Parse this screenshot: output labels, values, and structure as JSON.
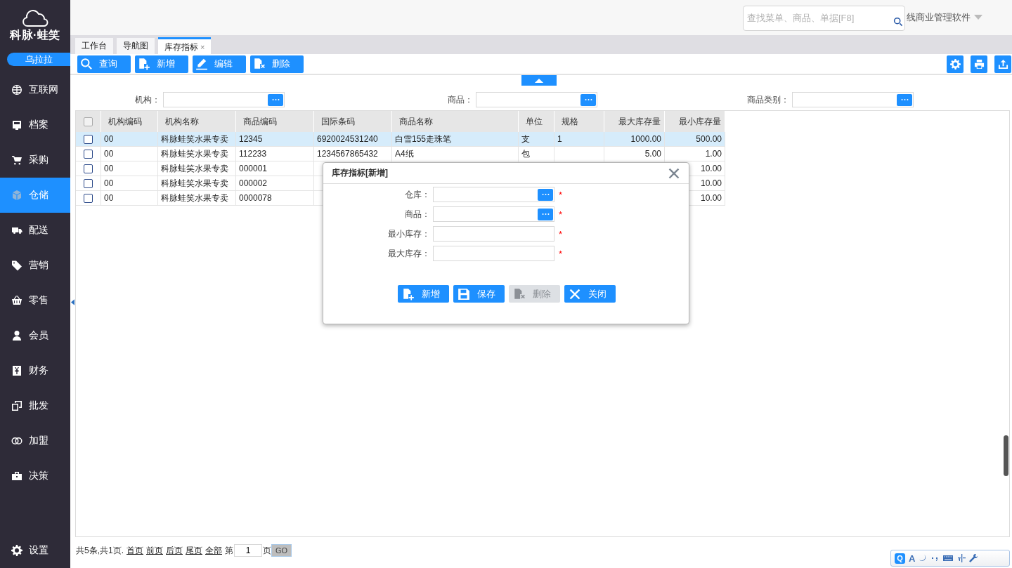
{
  "sidebar": {
    "logo": "科脉·蛙笑",
    "user": "乌拉拉",
    "items": [
      {
        "label": "互联网",
        "kind": "globe",
        "selected": false
      },
      {
        "label": "档案",
        "kind": "file",
        "selected": false
      },
      {
        "label": "采购",
        "kind": "cart",
        "selected": false
      },
      {
        "label": "仓储",
        "kind": "box",
        "selected": true
      },
      {
        "label": "配送",
        "kind": "truck",
        "selected": false
      },
      {
        "label": "营销",
        "kind": "tag",
        "selected": false
      },
      {
        "label": "零售",
        "kind": "basket",
        "selected": false
      },
      {
        "label": "会员",
        "kind": "user",
        "selected": false
      },
      {
        "label": "财务",
        "kind": "yen",
        "selected": false
      },
      {
        "label": "批发",
        "kind": "share",
        "selected": false
      },
      {
        "label": "加盟",
        "kind": "rings",
        "selected": false
      },
      {
        "label": "决策",
        "kind": "briefcase",
        "selected": false
      }
    ],
    "settings": "设置"
  },
  "header": {
    "search": {
      "placeholder": "查找菜单、商品、单据[F8]"
    },
    "product": "线商业管理软件"
  },
  "tabs": [
    {
      "label": "工作台",
      "selected": false
    },
    {
      "label": "导航图",
      "selected": false
    },
    {
      "label": "库存指标",
      "selected": true,
      "close_mark": "×"
    }
  ],
  "toolbar": {
    "buttons": [
      {
        "label": "查询",
        "kind": "search"
      },
      {
        "label": "新增",
        "kind": "add"
      },
      {
        "label": "编辑",
        "kind": "pencil"
      },
      {
        "label": "删除",
        "kind": "del"
      }
    ],
    "tools": [
      {
        "kind": "gear"
      },
      {
        "kind": "print"
      },
      {
        "kind": "export"
      }
    ]
  },
  "filters": [
    {
      "label": "机构：",
      "picker": true
    },
    {
      "label": "商品：",
      "picker": true
    },
    {
      "label": "商品类别：",
      "picker": true
    }
  ],
  "table": {
    "header_checked": false,
    "columns": [
      {
        "name": "机构编码",
        "numeric": false
      },
      {
        "name": "机构名称",
        "numeric": false
      },
      {
        "name": "商品编码",
        "numeric": false
      },
      {
        "name": "国际条码",
        "numeric": false
      },
      {
        "name": "商品名称",
        "numeric": false
      },
      {
        "name": "单位",
        "numeric": false
      },
      {
        "name": "规格",
        "numeric": false
      },
      {
        "name": "最大库存量",
        "numeric": true
      },
      {
        "name": "最小库存量",
        "numeric": true
      }
    ],
    "rows": [
      {
        "selected": true,
        "checked": false,
        "cells": [
          "00",
          "科脉蛙笑水果专卖",
          "12345",
          "6920024531240",
          "白雪155走珠笔",
          "支",
          "1",
          "1000.00",
          "500.00"
        ]
      },
      {
        "selected": false,
        "checked": false,
        "cells": [
          "00",
          "科脉蛙笑水果专卖",
          "112233",
          "1234567865432",
          "A4纸",
          "包",
          null,
          "5.00",
          "1.00"
        ]
      },
      {
        "selected": false,
        "checked": false,
        "cells": [
          "00",
          "科脉蛙笑水果专卖",
          "000001",
          null,
          null,
          null,
          null,
          null,
          "10.00"
        ]
      },
      {
        "selected": false,
        "checked": false,
        "cells": [
          "00",
          "科脉蛙笑水果专卖",
          "000002",
          null,
          null,
          null,
          null,
          null,
          "10.00"
        ]
      },
      {
        "selected": false,
        "checked": false,
        "cells": [
          "00",
          "科脉蛙笑水果专卖",
          "0000078",
          null,
          null,
          null,
          null,
          null,
          "10.00"
        ]
      }
    ]
  },
  "pagination": {
    "summary": "共5条,共1页.",
    "links": [
      "首页",
      "前页",
      "后页",
      "尾页",
      "全部"
    ],
    "page_prefix": "第",
    "page": "1",
    "page_suffix": "页",
    "go": "GO"
  },
  "dialog": {
    "title": "库存指标[新增]",
    "fields": [
      {
        "label": "仓库：",
        "picker": true,
        "required_mark": "*"
      },
      {
        "label": "商品：",
        "picker": true,
        "required_mark": "*"
      },
      {
        "label": "最小库存：",
        "picker": false,
        "required_mark": "*"
      },
      {
        "label": "最大库存：",
        "picker": false,
        "required_mark": "*"
      }
    ],
    "buttons": [
      {
        "label": "新增",
        "kind": "add",
        "disabled": false
      },
      {
        "label": "保存",
        "kind": "save",
        "disabled": false
      },
      {
        "label": "删除",
        "kind": "del",
        "disabled": true
      },
      {
        "label": "关闭",
        "kind": "x",
        "disabled": false
      }
    ]
  },
  "ime_toolbar": {
    "letters": [
      "Q",
      "A"
    ]
  }
}
